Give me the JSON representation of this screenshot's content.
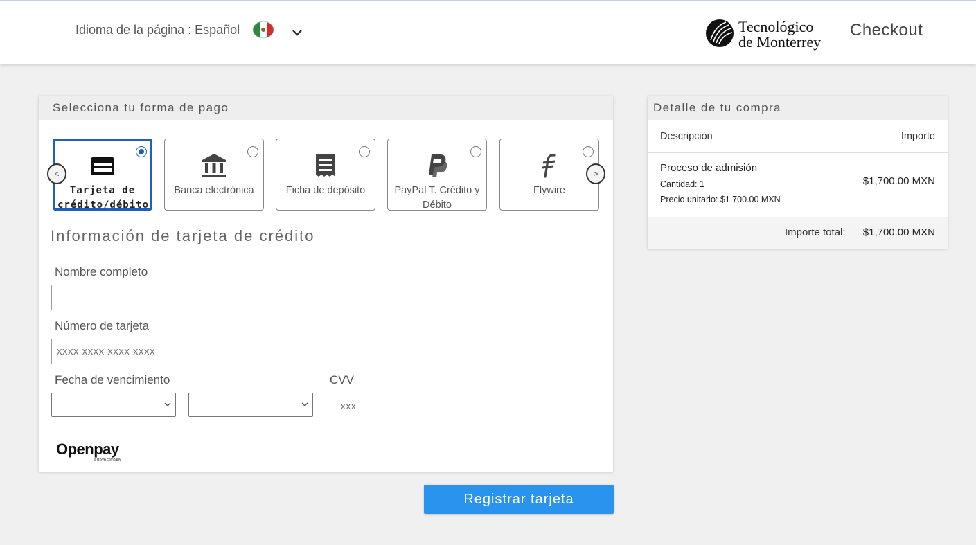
{
  "header": {
    "language_label": "Idioma de la página : Español",
    "language_flag": "mexico-flag-icon",
    "logo_line1": "Tecnológico",
    "logo_line2": "de Monterrey",
    "checkout_label": "Checkout"
  },
  "payment": {
    "panel_title": "Selecciona tu forma de pago",
    "prev_arrow": "<",
    "next_arrow": ">",
    "methods": [
      {
        "label": "Tarjeta de crédito/débito",
        "icon": "credit-card-icon",
        "selected": true
      },
      {
        "label": "Banca electrónica",
        "icon": "bank-icon",
        "selected": false
      },
      {
        "label": "Ficha de depósito",
        "icon": "receipt-icon",
        "selected": false
      },
      {
        "label": "PayPal T. Crédito y Débito",
        "icon": "paypal-icon",
        "selected": false
      },
      {
        "label": "Flywire",
        "icon": "flywire-icon",
        "selected": false
      }
    ],
    "card_section_title": "Información de tarjeta de crédito",
    "name_label": "Nombre completo",
    "name_value": "",
    "card_number_label": "Número de tarjeta",
    "card_number_placeholder": "xxxx xxxx xxxx xxxx",
    "expiry_label": "Fecha de vencimiento",
    "expiry_month_value": "",
    "expiry_year_value": "",
    "cvv_label": "CVV",
    "cvv_placeholder": "xxx",
    "provider_logo": "Openpay",
    "provider_logo_sub": "a BBVA company",
    "register_button": "Registrar tarjeta"
  },
  "order": {
    "panel_title": "Detalle de tu compra",
    "col_description": "Descripción",
    "col_amount": "Importe",
    "item_name": "Proceso de admisión",
    "item_quantity": "Cantidad: 1",
    "item_unit_price": "Precio unitario: $1,700.00 MXN",
    "item_amount": "$1,700.00  MXN",
    "total_label": "Importe total:",
    "total_value": "$1,700.00  MXN"
  },
  "colors": {
    "accent_blue": "#1f5fbf",
    "button_blue": "#2a93ee",
    "background": "#f0f0f0"
  }
}
